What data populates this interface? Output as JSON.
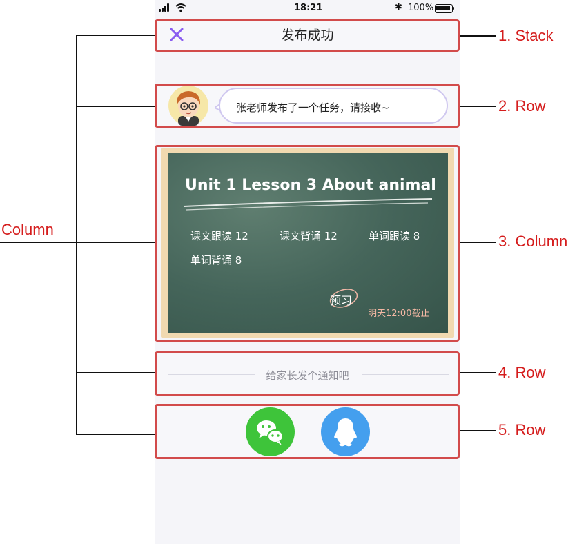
{
  "status_bar": {
    "time": "18:21",
    "battery": "100%"
  },
  "nav": {
    "title": "发布成功"
  },
  "message": {
    "text": "张老师发布了一个任务，请接收~"
  },
  "board": {
    "title": "Unit 1 Lesson 3 About animal",
    "tasks": [
      "课文跟读 12",
      "课文背诵 12",
      "单词跟读 8",
      "单词背诵 8"
    ],
    "stamp": "预习",
    "deadline": "明天12:00截止"
  },
  "notice": {
    "text": "给家长发个通知吧"
  },
  "share": {
    "icons": [
      "wechat-icon",
      "qq-icon"
    ]
  },
  "annotations": {
    "left": "Column",
    "items": [
      "1. Stack",
      "2. Row",
      "3. Column",
      "4. Row",
      "5. Row"
    ]
  },
  "colors": {
    "annotation_red": "#d51d1d",
    "box_red": "#d24b4b",
    "accent_purple": "#8a5cf0",
    "wechat_green": "#3ec43a",
    "qq_blue": "#449fee",
    "board_green": "#45655a",
    "deadline_text": "#f4b8a4"
  }
}
